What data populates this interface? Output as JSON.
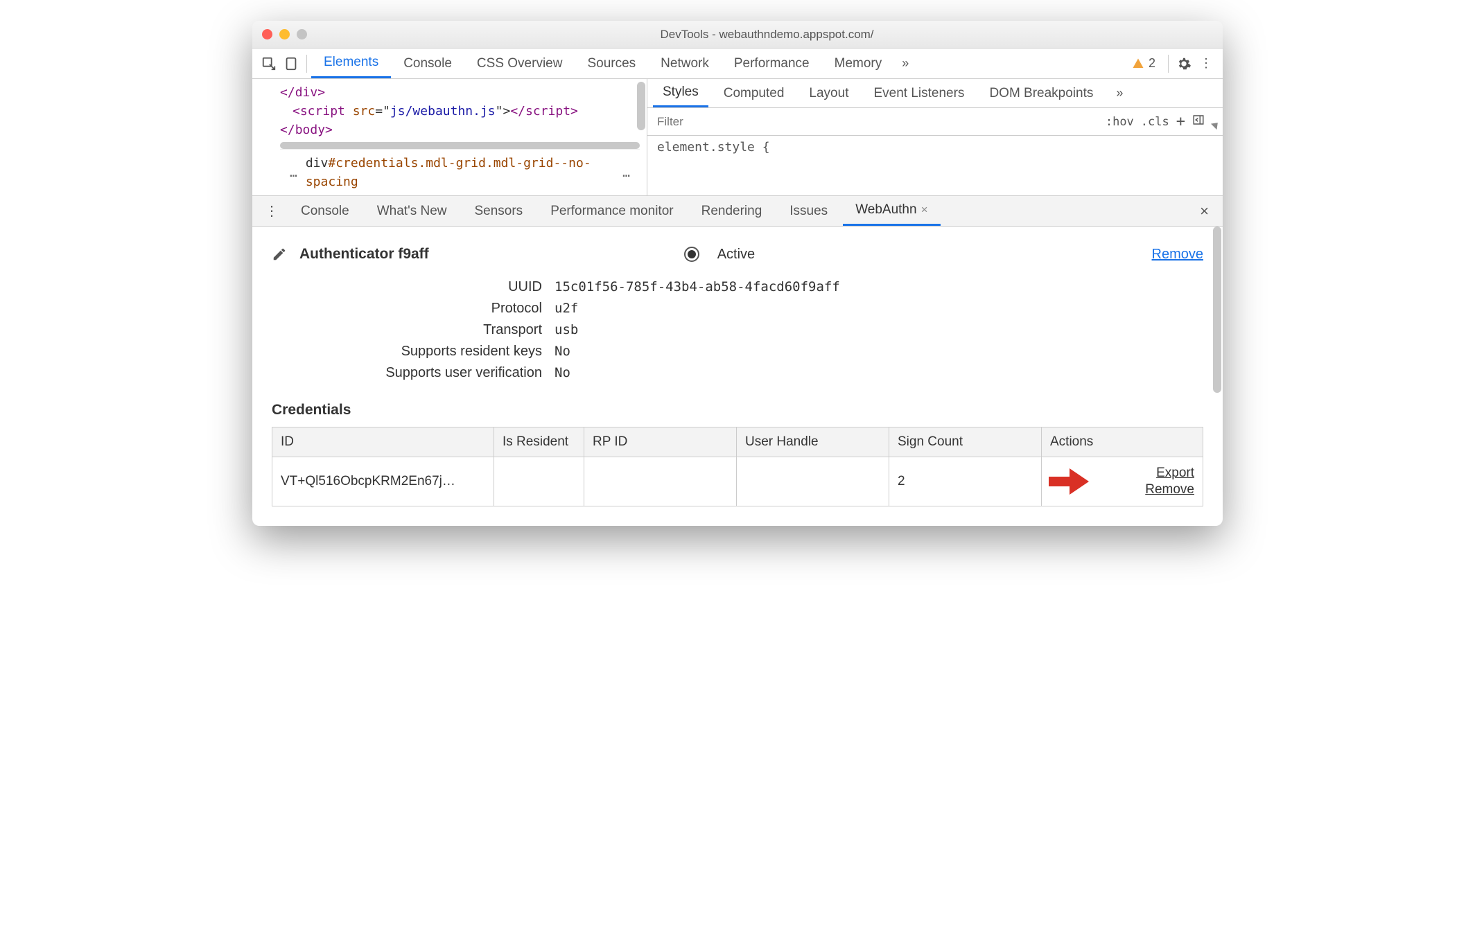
{
  "titlebar": {
    "title": "DevTools - webauthndemo.appspot.com/"
  },
  "main_tabs": {
    "items": [
      "Elements",
      "Console",
      "CSS Overview",
      "Sources",
      "Network",
      "Performance",
      "Memory"
    ],
    "active_index": 0,
    "warning_count": "2"
  },
  "elements_panel": {
    "code": {
      "l1_open": "</",
      "l1_tag": "div",
      "l1_close": ">",
      "l2_open": "<",
      "l2_tag": "script",
      "l2_attr": " src",
      "l2_eq": "=\"",
      "l2_val": "js/webauthn.js",
      "l2_q2": "\">",
      "l2_ct": "</",
      "l2_tag2": "script",
      "l2_end": ">",
      "l3_open": "</",
      "l3_tag": "body",
      "l3_close": ">"
    },
    "breadcrumb": {
      "prefix": "…",
      "sel_tag": "div",
      "sel_id": "#credentials",
      "sel_cls": ".mdl-grid.mdl-grid--no-spacing",
      "suffix": "…"
    }
  },
  "styles_panel": {
    "tabs": [
      "Styles",
      "Computed",
      "Layout",
      "Event Listeners",
      "DOM Breakpoints"
    ],
    "active_index": 0,
    "filter_placeholder": "Filter",
    "hov": ":hov",
    "cls": ".cls",
    "element_style": "element.style {"
  },
  "drawer": {
    "tabs": [
      "Console",
      "What's New",
      "Sensors",
      "Performance monitor",
      "Rendering",
      "Issues",
      "WebAuthn"
    ],
    "active_index": 6
  },
  "webauthn": {
    "authenticator_name": "Authenticator f9aff",
    "active_label": "Active",
    "remove_label": "Remove",
    "props": {
      "uuid_k": "UUID",
      "uuid_v": "15c01f56-785f-43b4-ab58-4facd60f9aff",
      "proto_k": "Protocol",
      "proto_v": "u2f",
      "trans_k": "Transport",
      "trans_v": "usb",
      "rk_k": "Supports resident keys",
      "rk_v": "No",
      "uv_k": "Supports user verification",
      "uv_v": "No"
    },
    "credentials_heading": "Credentials",
    "table": {
      "headers": [
        "ID",
        "Is Resident",
        "RP ID",
        "User Handle",
        "Sign Count",
        "Actions"
      ],
      "rows": [
        {
          "id": "VT+Ql516ObcpKRM2En67j…",
          "is_resident": "",
          "rp_id": "",
          "user_handle": "",
          "sign_count": "2",
          "export": "Export",
          "remove": "Remove"
        }
      ]
    }
  }
}
